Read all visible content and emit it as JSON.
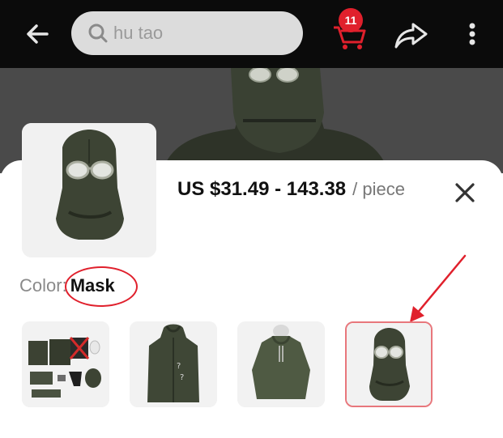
{
  "header": {
    "search_text": "hu tao",
    "cart_count": "11",
    "icons": [
      "back-arrow-icon",
      "search-icon",
      "cart-icon",
      "share-icon",
      "more-vertical-icon"
    ]
  },
  "sheet": {
    "price": "US $31.49 - 143.38",
    "unit": "/ piece",
    "color_label": "Color:",
    "color_value": "Mask",
    "options": [
      {
        "name": "full-set"
      },
      {
        "name": "long-coat"
      },
      {
        "name": "hoodie"
      },
      {
        "name": "mask",
        "selected": true
      }
    ]
  },
  "colors": {
    "topbar": "#0b0b0b",
    "accent_red": "#e0202c",
    "selected_border": "#e8777c"
  }
}
